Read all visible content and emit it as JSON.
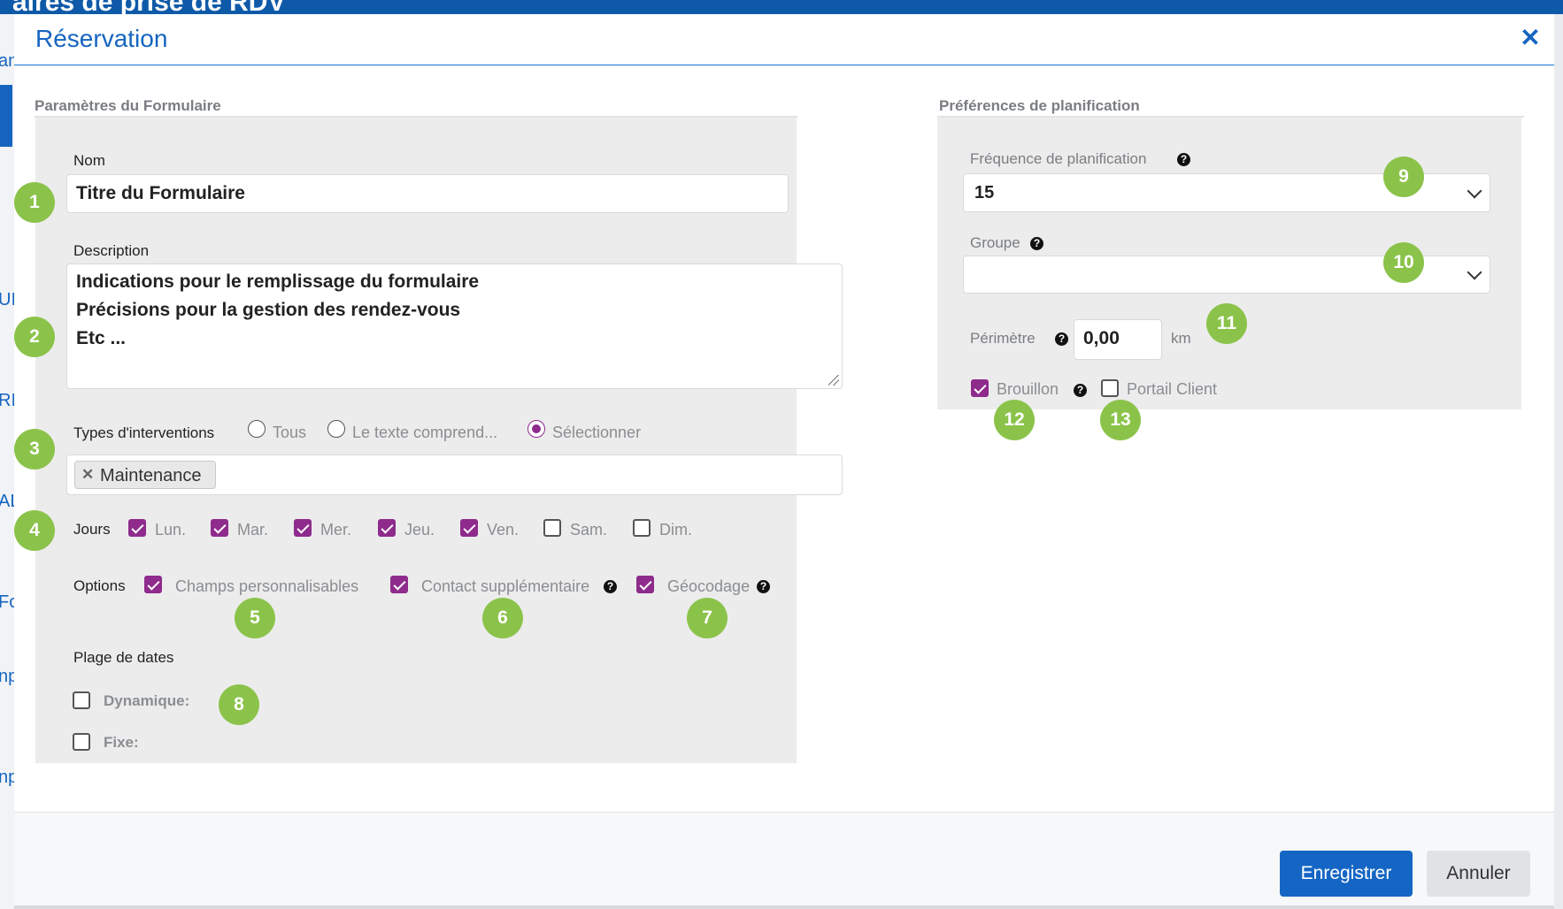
{
  "background": {
    "header_title": "aires de prise de RDV",
    "left_fragments": [
      "an",
      "UI",
      "RIS",
      "AL",
      "Fo",
      "np",
      "np"
    ]
  },
  "modal": {
    "title": "Réservation",
    "close_icon": "close-icon"
  },
  "form_settings": {
    "section_title": "Paramètres du Formulaire",
    "name_label": "Nom",
    "name_value": "Titre du Formulaire",
    "description_label": "Description",
    "description_lines": [
      "Indications pour le remplissage du formulaire",
      "Précisions pour la gestion des rendez-vous",
      "Etc ..."
    ],
    "intervention_types": {
      "label": "Types d'interventions",
      "options": [
        {
          "label": "Tous",
          "selected": false
        },
        {
          "label": "Le texte comprend...",
          "selected": false
        },
        {
          "label": "Sélectionner",
          "selected": true
        }
      ],
      "tags": [
        "Maintenance"
      ]
    },
    "days": {
      "label": "Jours",
      "items": [
        {
          "label": "Lun.",
          "checked": true
        },
        {
          "label": "Mar.",
          "checked": true
        },
        {
          "label": "Mer.",
          "checked": true
        },
        {
          "label": "Jeu.",
          "checked": true
        },
        {
          "label": "Ven.",
          "checked": true
        },
        {
          "label": "Sam.",
          "checked": false
        },
        {
          "label": "Dim.",
          "checked": false
        }
      ]
    },
    "options": {
      "label": "Options",
      "items": [
        {
          "label": "Champs personnalisables",
          "checked": true
        },
        {
          "label": "Contact supplémentaire",
          "checked": true,
          "help": true
        },
        {
          "label": "Géocodage",
          "checked": true,
          "help": true
        }
      ]
    },
    "date_range": {
      "label": "Plage de dates",
      "items": [
        {
          "label": "Dynamique:",
          "checked": false
        },
        {
          "label": "Fixe:",
          "checked": false
        }
      ]
    }
  },
  "planning_prefs": {
    "section_title": "Préférences de planification",
    "frequency_label": "Fréquence de planification",
    "frequency_value": "15",
    "group_label": "Groupe",
    "group_value": "",
    "perimeter_label": "Périmètre",
    "perimeter_value": "0,00",
    "perimeter_unit": "km",
    "draft": {
      "label": "Brouillon",
      "checked": true
    },
    "client_portal": {
      "label": "Portail Client",
      "checked": false
    }
  },
  "badges": [
    "1",
    "2",
    "3",
    "4",
    "5",
    "6",
    "7",
    "8",
    "9",
    "10",
    "11",
    "12",
    "13"
  ],
  "footer": {
    "save_label": "Enregistrer",
    "cancel_label": "Annuler"
  },
  "colors": {
    "brand_blue": "#1565c0",
    "checkbox_purple": "#8e2b8c",
    "badge_green": "#8bc34a"
  }
}
